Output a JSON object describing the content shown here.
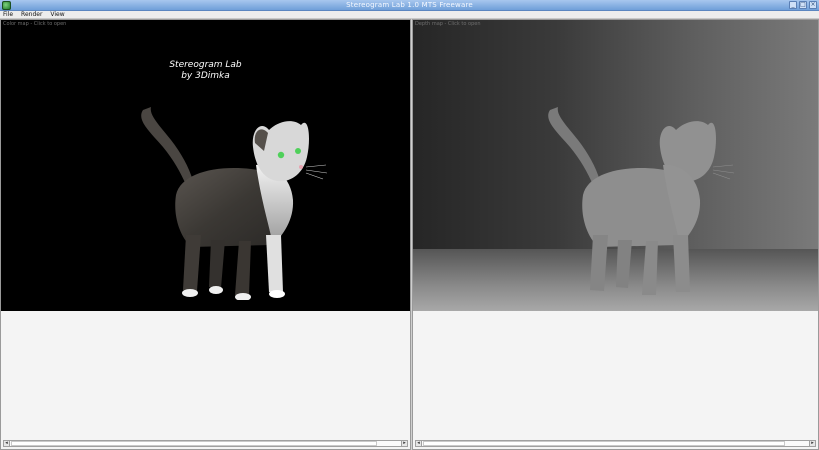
{
  "window": {
    "title": "Stereogram Lab 1.0 MTS Freeware",
    "controls": [
      "minimize",
      "maximize",
      "close"
    ]
  },
  "menu": {
    "items": [
      {
        "label": "File",
        "accel": "F"
      },
      {
        "label": "Render",
        "accel": "R"
      },
      {
        "label": "View",
        "accel": "V"
      }
    ]
  },
  "left_pane": {
    "hint": "Color map - Click to open",
    "credit_line1": "Stereogram Lab",
    "credit_line2": "by 3Dimka"
  },
  "right_pane": {
    "hint": "Depth map - Click to open"
  },
  "colors": {
    "title_gradient_top": "#a8c7ee",
    "title_gradient_bottom": "#6f9fd9",
    "color_map_bg": "#000000",
    "depth_silhouette": "#8c8c8c"
  }
}
